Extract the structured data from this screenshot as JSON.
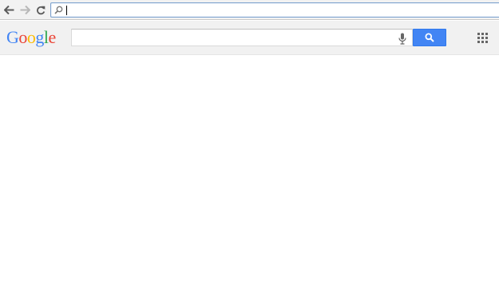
{
  "browser": {
    "nav": {
      "back_icon": "arrow-left-icon",
      "forward_icon": "arrow-right-icon",
      "reload_icon": "reload-icon"
    },
    "omnibox": {
      "value": "",
      "placeholder": "",
      "icon": "search-icon"
    }
  },
  "google_bar": {
    "logo_letters": [
      "G",
      "o",
      "o",
      "g",
      "l",
      "e"
    ],
    "logo_colors": [
      "#4285f4",
      "#ea4335",
      "#fbbc05",
      "#4285f4",
      "#34a853",
      "#ea4335"
    ],
    "search": {
      "value": "",
      "placeholder": "",
      "mic_icon": "microphone-icon",
      "button_icon": "search-icon",
      "button_color": "#4285f4"
    },
    "apps_icon": "apps-grid-icon"
  }
}
